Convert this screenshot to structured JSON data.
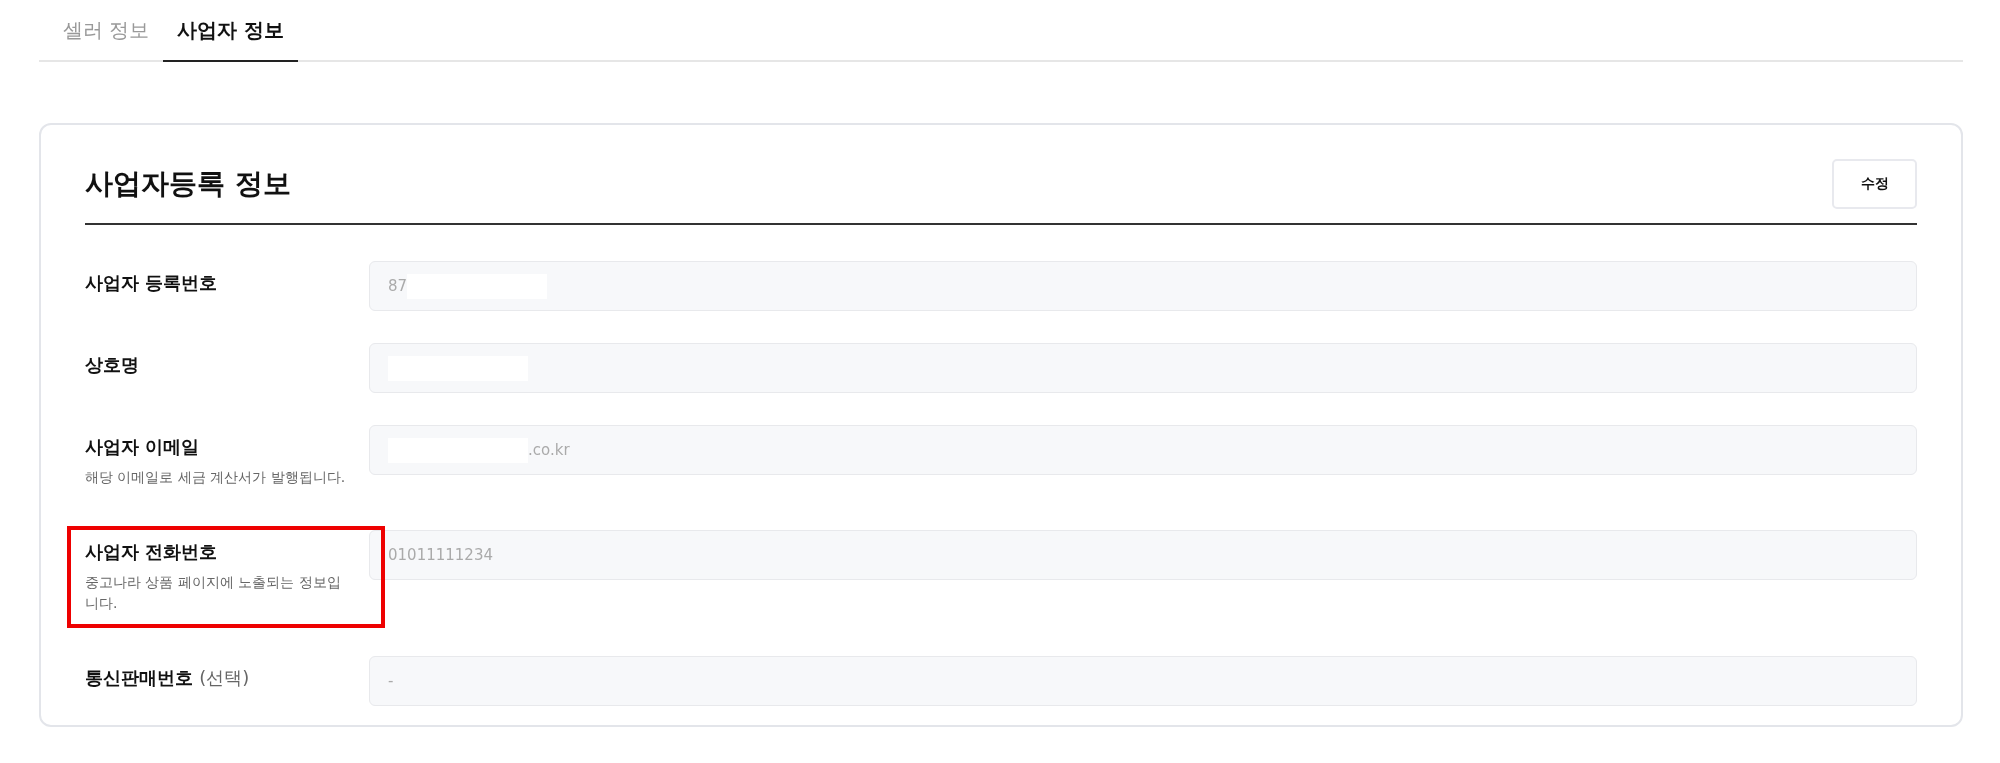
{
  "tabs": [
    {
      "label": "셀러 정보",
      "selected": false
    },
    {
      "label": "사업자 정보",
      "selected": true
    }
  ],
  "section": {
    "title": "사업자등록 정보",
    "edit_button": "수정"
  },
  "rows": [
    {
      "label": "사업자 등록번호",
      "value": [
        {
          "kind": "text",
          "text": "87"
        },
        {
          "kind": "redacted"
        }
      ],
      "highlighted": false
    },
    {
      "label": "상호명",
      "value": [
        {
          "kind": "redacted"
        }
      ],
      "highlighted": false
    },
    {
      "label": "사업자 이메일",
      "description": "해당 이메일로 세금 계산서가 발행됩니다.",
      "value": [
        {
          "kind": "redacted"
        },
        {
          "kind": "text",
          "text": ".co.kr"
        }
      ],
      "highlighted": false
    },
    {
      "label": "사업자 전화번호",
      "description": "중고나라 상품 페이지에 노출되는 정보입니다.",
      "value": [
        {
          "kind": "text",
          "text": "01011111234"
        }
      ],
      "highlighted": true
    },
    {
      "label": "통신판매번호",
      "note": "(선택)",
      "value": [
        {
          "kind": "text",
          "text": "-"
        }
      ],
      "highlighted": false
    }
  ]
}
